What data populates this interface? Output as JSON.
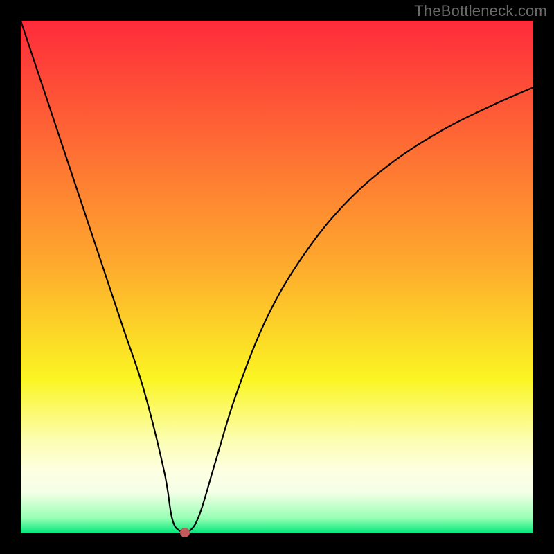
{
  "watermark": "TheBottleneck.com",
  "chart_data": {
    "type": "line",
    "title": "",
    "xlabel": "",
    "ylabel": "",
    "xlim": [
      0,
      100
    ],
    "ylim": [
      0,
      100
    ],
    "grid": false,
    "x": [
      0,
      4,
      8,
      12,
      16,
      20,
      24,
      28,
      29.5,
      31,
      33,
      35,
      38,
      42,
      48,
      55,
      63,
      72,
      82,
      92,
      100
    ],
    "values": [
      100,
      88,
      76,
      64,
      52,
      40,
      28,
      12,
      3,
      0.5,
      0.5,
      4,
      14,
      27,
      42,
      54,
      64,
      72,
      78.5,
      83.5,
      87
    ],
    "marker": {
      "x": 32,
      "y": 0.2
    },
    "gradient_stops": [
      {
        "pos": 0,
        "color": "#fe2b3b"
      },
      {
        "pos": 48,
        "color": "#feab2d"
      },
      {
        "pos": 70,
        "color": "#fbf523"
      },
      {
        "pos": 82,
        "color": "#fcfeb3"
      },
      {
        "pos": 88,
        "color": "#fdffe3"
      },
      {
        "pos": 92,
        "color": "#f4ffe7"
      },
      {
        "pos": 97,
        "color": "#99ffb5"
      },
      {
        "pos": 100,
        "color": "#00e87a"
      }
    ]
  },
  "plot": {
    "inner_left": 30,
    "inner_top": 30,
    "inner_size": 740
  }
}
